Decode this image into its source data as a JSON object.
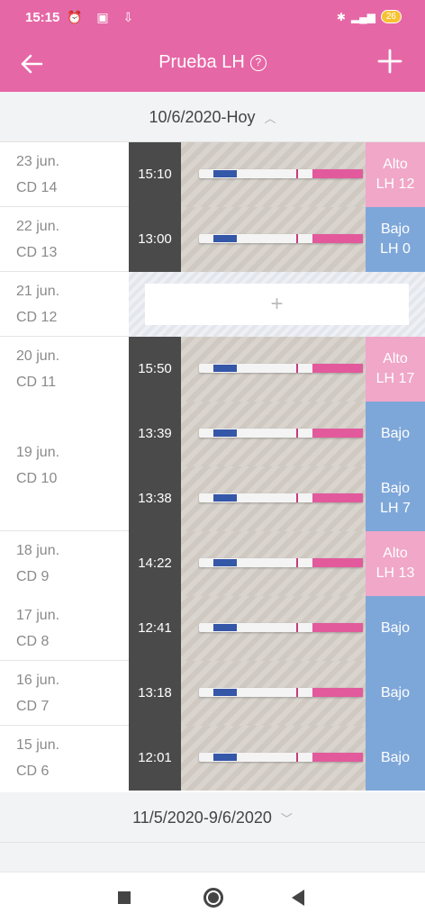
{
  "status": {
    "time": "15:15",
    "battery": "26"
  },
  "appbar": {
    "title": "Prueba LH",
    "help": "?"
  },
  "range_top": {
    "label": "10/6/2020-Hoy",
    "chevron": "^"
  },
  "range_bottom": {
    "label": "11/5/2020-9/6/2020",
    "chevron": "v"
  },
  "days": [
    {
      "date": "23 jun.",
      "cd": "CD 14"
    },
    {
      "date": "22 jun.",
      "cd": "CD 13"
    },
    {
      "date": "21 jun.",
      "cd": "CD 12"
    },
    {
      "date": "20 jun.",
      "cd": "CD 11"
    },
    {
      "date": "19 jun.",
      "cd": "CD 10"
    },
    {
      "date": "18 jun.",
      "cd": "CD 9"
    },
    {
      "date": "17 jun.",
      "cd": "CD 8"
    },
    {
      "date": "16 jun.",
      "cd": "CD 7"
    },
    {
      "date": "15 jun.",
      "cd": "CD 6"
    }
  ],
  "tests": [
    {
      "time": "15:10",
      "level": "Alto",
      "lh": "LH 12"
    },
    {
      "time": "13:00",
      "level": "Bajo",
      "lh": "LH 0"
    },
    {
      "time": "15:50",
      "level": "Alto",
      "lh": "LH 17"
    },
    {
      "time": "13:39",
      "level": "Bajo",
      "lh": ""
    },
    {
      "time": "13:38",
      "level": "Bajo",
      "lh": "LH 7"
    },
    {
      "time": "14:22",
      "level": "Alto",
      "lh": "LH 13"
    },
    {
      "time": "12:41",
      "level": "Bajo",
      "lh": ""
    },
    {
      "time": "13:18",
      "level": "Bajo",
      "lh": ""
    },
    {
      "time": "12:01",
      "level": "Bajo",
      "lh": ""
    }
  ],
  "empty_add": "+",
  "colors": {
    "brand": "#e667a6",
    "alto": "#f0a7c8",
    "bajo": "#7ea7d9"
  },
  "icons": [
    "back-arrow-icon",
    "help-circle-icon",
    "add-icon",
    "nav-recents-icon",
    "nav-home-icon",
    "nav-back-icon"
  ]
}
